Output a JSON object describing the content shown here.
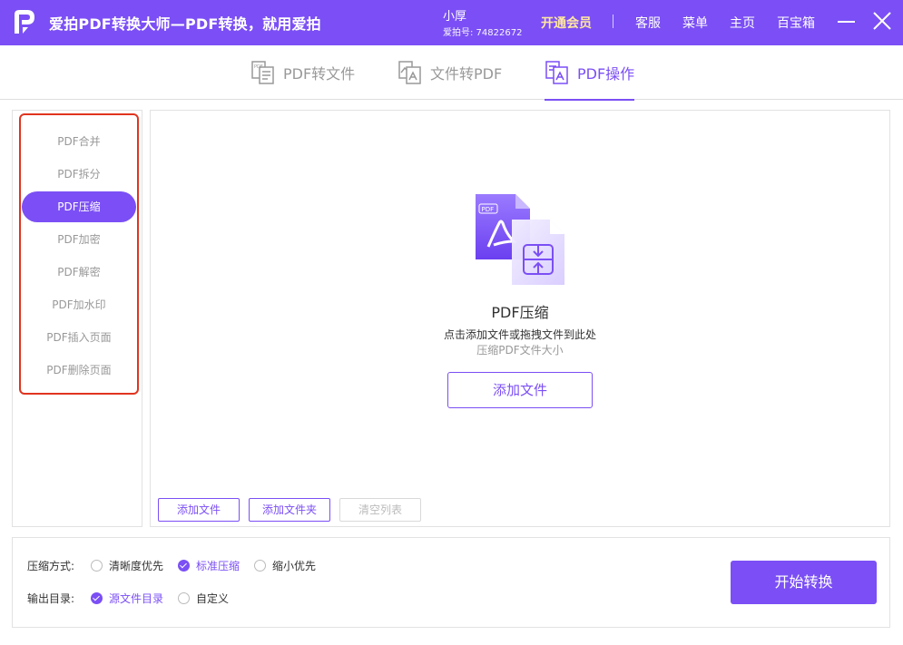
{
  "app": {
    "title": "爱拍PDF转换大师—PDF转换，就用爱拍",
    "accent_color": "#7b4ff5"
  },
  "user": {
    "name": "小厚",
    "id_text": "爱拍号: 74822672"
  },
  "titlebar": {
    "vip_label": "开通会员",
    "links": [
      "客服",
      "菜单",
      "主页",
      "百宝箱"
    ],
    "minimize_icon": "minimize-icon",
    "close_icon": "close-icon"
  },
  "tabs": [
    {
      "label": "PDF转文件",
      "icon": "pdf-to-file-icon",
      "active": false
    },
    {
      "label": "文件转PDF",
      "icon": "file-to-pdf-icon",
      "active": false
    },
    {
      "label": "PDF操作",
      "icon": "pdf-operation-icon",
      "active": true
    }
  ],
  "sidebar": {
    "items": [
      {
        "label": "PDF合并",
        "active": false
      },
      {
        "label": "PDF拆分",
        "active": false
      },
      {
        "label": "PDF压缩",
        "active": true
      },
      {
        "label": "PDF加密",
        "active": false
      },
      {
        "label": "PDF解密",
        "active": false
      },
      {
        "label": "PDF加水印",
        "active": false
      },
      {
        "label": "PDF插入页面",
        "active": false
      },
      {
        "label": "PDF删除页面",
        "active": false
      }
    ]
  },
  "main": {
    "illustration_icon": "pdf-compress-icon",
    "illustration_badge": "PDF",
    "title": "PDF压缩",
    "hint": "点击添加文件或拖拽文件到此处",
    "subhint": "压缩PDF文件大小",
    "add_file_label": "添加文件",
    "buttons": {
      "add_file": "添加文件",
      "add_folder": "添加文件夹",
      "clear_list": "清空列表"
    }
  },
  "options": {
    "compress_mode_label": "压缩方式:",
    "compress_modes": [
      {
        "label": "清晰度优先",
        "checked": false
      },
      {
        "label": "标准压缩",
        "checked": true
      },
      {
        "label": "缩小优先",
        "checked": false
      }
    ],
    "output_dir_label": "输出目录:",
    "output_dirs": [
      {
        "label": "源文件目录",
        "checked": true
      },
      {
        "label": "自定义",
        "checked": false
      }
    ],
    "start_label": "开始转换"
  }
}
